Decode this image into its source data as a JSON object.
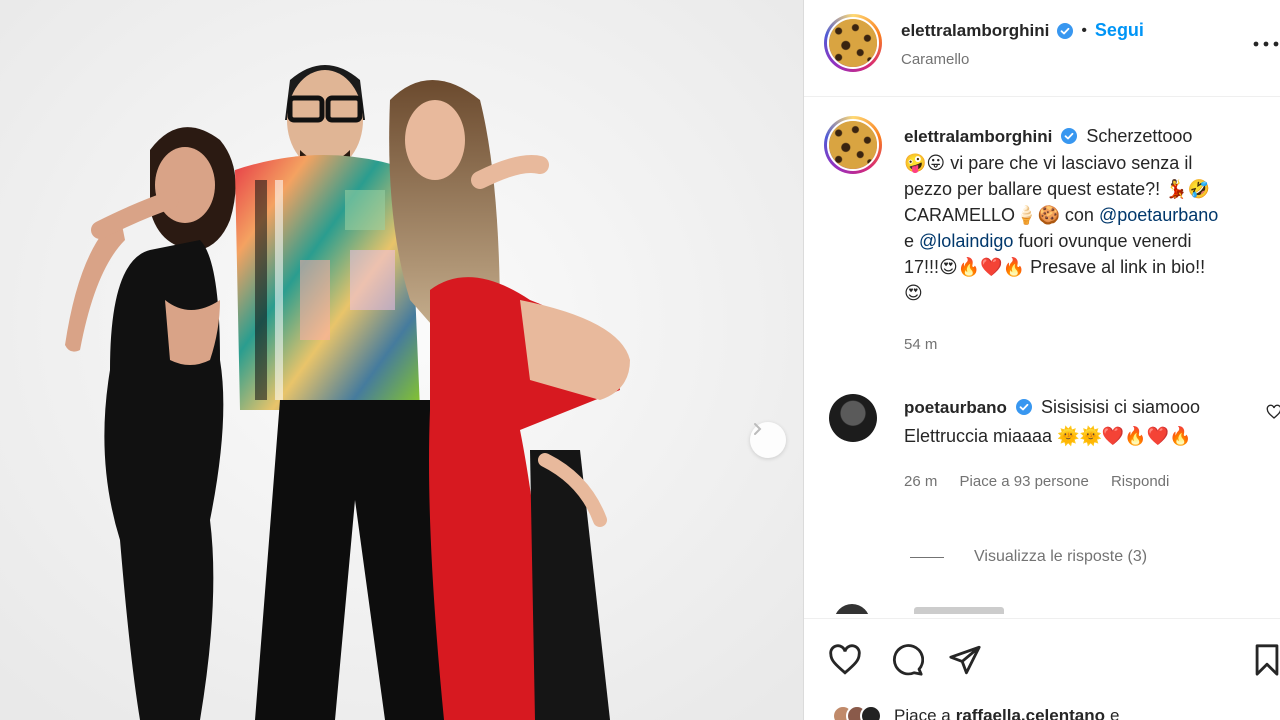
{
  "post": {
    "author": "elettralamborghini",
    "follow_label": "Segui",
    "separator": "•",
    "audio_label": "Caramello",
    "more_label": "..."
  },
  "caption": {
    "author": "elettralamborghini",
    "line1": "Scherzettooo",
    "line2": "vi pare che vi lasciavo senza il",
    "line3": "pezzo per ballare quest estate?!",
    "line4a": "CARAMELLO",
    "line4b": "con",
    "mention1": "@poetaurbano",
    "line5a": "e",
    "mention2": "@lolaindigo",
    "line5b": "fuori ovunque venerdi",
    "line6a": "17!!!",
    "line6b": "Presave al link in bio!!",
    "time": "54 m"
  },
  "comment": {
    "author": "poetaurbano",
    "text1": "Sisisisisi ci siamooo",
    "text2": "Elettruccia miaaaa",
    "time": "26 m",
    "likes": "Piace a 93 persone",
    "reply": "Rispondi",
    "view_replies": "Visualizza le risposte (3)"
  },
  "footer": {
    "likes_prefix": "Piace a",
    "likes_user": "raffaella.celentano",
    "likes_suffix": "e"
  },
  "colors": {
    "accent": "#0095f6",
    "verified": "#3897f0",
    "mention": "#00376b",
    "muted": "#737373"
  },
  "icons": [
    "verified-icon",
    "more-icon",
    "heart-icon",
    "comment-icon",
    "share-icon",
    "bookmark-icon",
    "chevron-right-icon"
  ]
}
